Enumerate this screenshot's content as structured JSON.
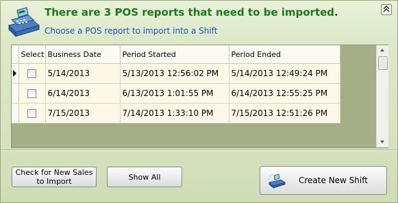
{
  "header": {
    "title": "There are 3 POS reports that need to be imported.",
    "subtitle": "Choose a POS report to import into a Shift",
    "icon": "cash-register-icon"
  },
  "grid": {
    "columns": [
      "Select",
      "Business Date",
      "Period Started",
      "Period Ended"
    ],
    "rows": [
      {
        "business_date": "5/14/2013",
        "period_started": "5/13/2013 12:56:02 PM",
        "period_ended": "5/14/2013 12:49:24 PM",
        "selected": false,
        "current": true
      },
      {
        "business_date": "6/14/2013",
        "period_started": "6/13/2013 1:01:55 PM",
        "period_ended": "6/14/2013 12:55:25 PM",
        "selected": false,
        "current": false
      },
      {
        "business_date": "7/15/2013",
        "period_started": "7/14/2013 1:33:10 PM",
        "period_ended": "7/15/2013 12:51:26 PM",
        "selected": false,
        "current": false
      }
    ]
  },
  "buttons": {
    "check_new_sales": "Check for New Sales to Import",
    "show_all": "Show All",
    "create_new_shift": "Create New Shift"
  },
  "colors": {
    "title_green": "#1b7a1b",
    "subtitle_blue": "#1a54b5",
    "panel_background": "#d9e4c4",
    "grid_empty_area": "#a5ae89",
    "row_background": "#fdf8e8"
  }
}
